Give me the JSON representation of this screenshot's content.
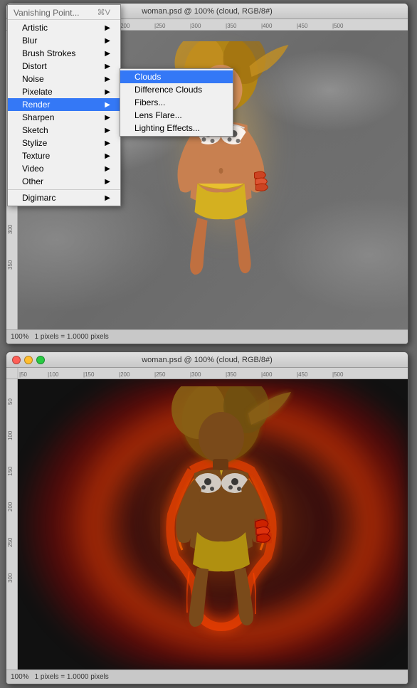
{
  "windows": {
    "top": {
      "title": "woman.psd @ 100% (cloud, RGB/8#)",
      "status": "100%",
      "status2": "1 pixels = 1.0000 pixels"
    },
    "bottom": {
      "title": "woman.psd @ 100% (cloud, RGB/8#)",
      "status": "100%",
      "status2": "1 pixels = 1.0000 pixels"
    }
  },
  "menu": {
    "title": "Vanishing Point...",
    "shortcut": "⌘V",
    "items": [
      {
        "label": "Artistic",
        "hasArrow": true,
        "active": false
      },
      {
        "label": "Blur",
        "hasArrow": true,
        "active": false
      },
      {
        "label": "Brush Strokes",
        "hasArrow": true,
        "active": false
      },
      {
        "label": "Distort",
        "hasArrow": true,
        "active": false
      },
      {
        "label": "Noise",
        "hasArrow": true,
        "active": false
      },
      {
        "label": "Pixelate",
        "hasArrow": true,
        "active": false
      },
      {
        "label": "Render",
        "hasArrow": true,
        "active": true
      },
      {
        "label": "Sharpen",
        "hasArrow": true,
        "active": false
      },
      {
        "label": "Sketch",
        "hasArrow": true,
        "active": false
      },
      {
        "label": "Stylize",
        "hasArrow": true,
        "active": false
      },
      {
        "label": "Texture",
        "hasArrow": true,
        "active": false
      },
      {
        "label": "Video",
        "hasArrow": true,
        "active": false
      },
      {
        "label": "Other",
        "hasArrow": true,
        "active": false
      },
      {
        "label": "Digimarc",
        "hasArrow": true,
        "active": false
      }
    ],
    "submenu": {
      "items": [
        {
          "label": "Clouds",
          "highlighted": true
        },
        {
          "label": "Difference Clouds",
          "highlighted": false
        },
        {
          "label": "Fibers...",
          "highlighted": false
        },
        {
          "label": "Lens Flare...",
          "highlighted": false
        },
        {
          "label": "Lighting Effects...",
          "highlighted": false
        }
      ]
    }
  }
}
